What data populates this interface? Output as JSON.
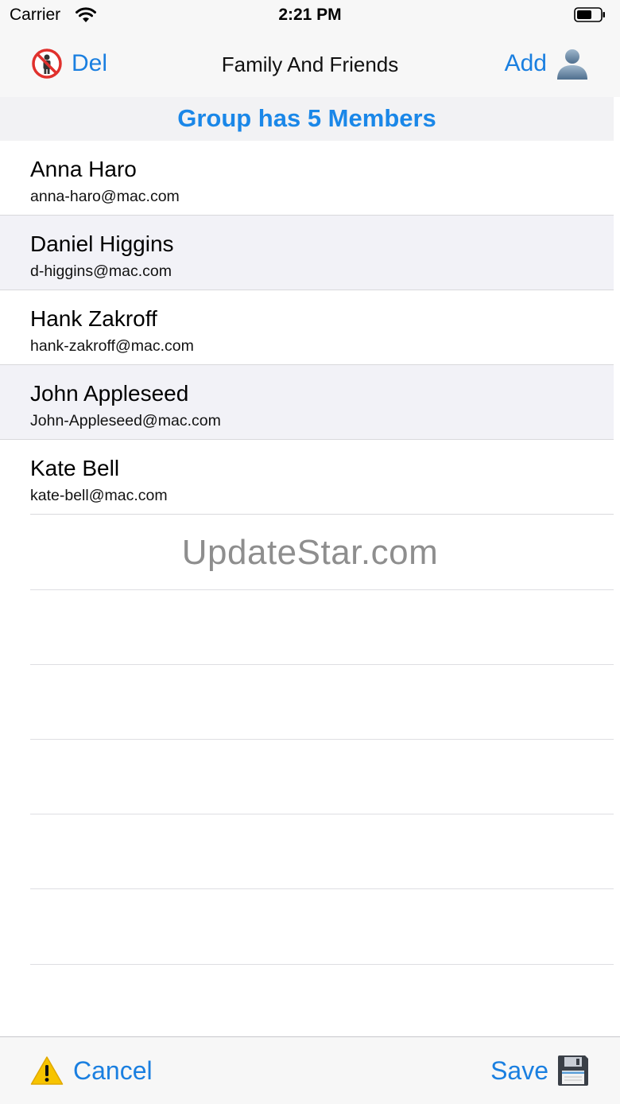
{
  "status_bar": {
    "carrier": "Carrier",
    "time": "2:21 PM"
  },
  "nav": {
    "del_label": "Del",
    "title": "Family And Friends",
    "add_label": "Add"
  },
  "group_header": "Group has 5 Members",
  "members": [
    {
      "name": "Anna Haro",
      "email": "anna-haro@mac.com"
    },
    {
      "name": "Daniel Higgins",
      "email": "d-higgins@mac.com"
    },
    {
      "name": "Hank Zakroff",
      "email": "hank-zakroff@mac.com"
    },
    {
      "name": "John Appleseed",
      "email": "John-Appleseed@mac.com"
    },
    {
      "name": "Kate Bell",
      "email": "kate-bell@mac.com"
    }
  ],
  "watermark": "UpdateStar.com",
  "toolbar": {
    "cancel_label": "Cancel",
    "save_label": "Save"
  },
  "colors": {
    "accent": "#1a7fe0",
    "header_text": "#1a87e8",
    "alt_row": "#f2f2f7"
  },
  "icons": {
    "del": "no-entry-icon",
    "add": "user-icon",
    "cancel": "warning-icon",
    "save": "floppy-disk-icon"
  }
}
